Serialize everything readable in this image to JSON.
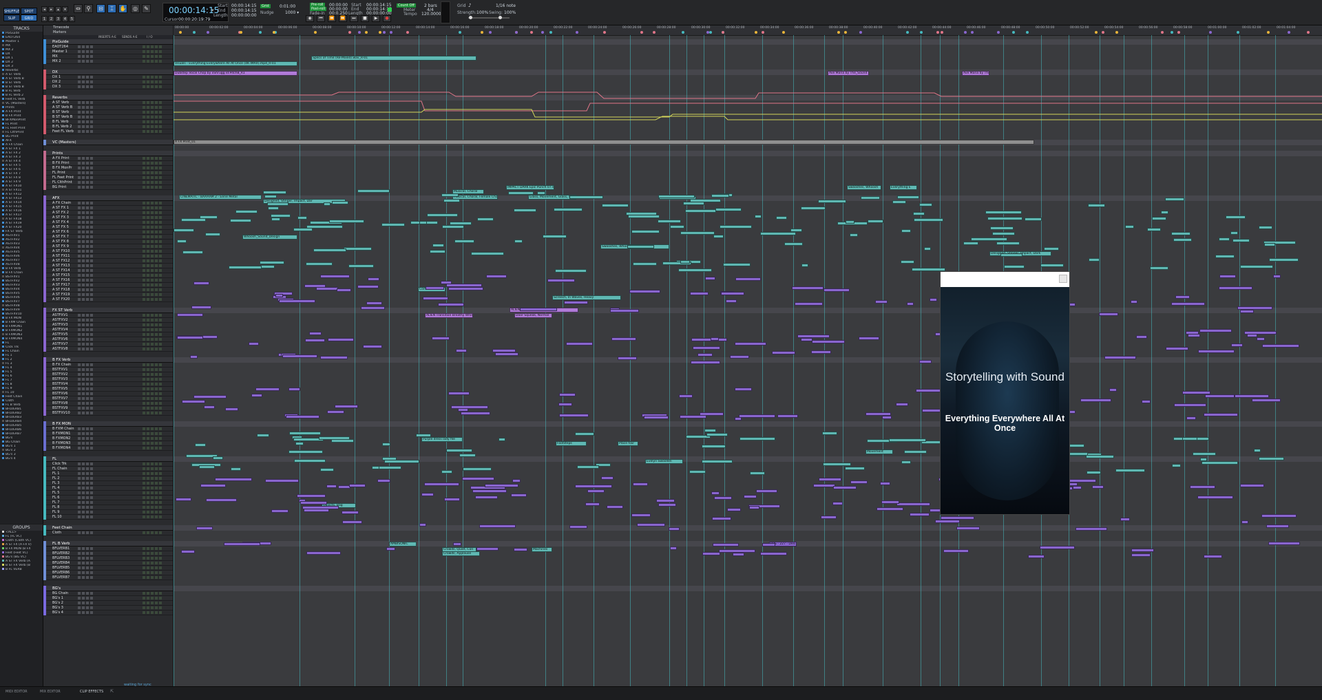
{
  "transport": {
    "mode_buttons": [
      "SHUFFLE",
      "SPOT",
      "SLIP",
      "GRID"
    ],
    "counter_main": "00:00:14:15",
    "counter_caret": "▾",
    "start_label": "Start",
    "start_value": "00:00:14:15",
    "end_label": "End",
    "end_value": "00:00:14:15",
    "length_label": "Length",
    "length_value": "00:00:00:00",
    "cursor_label": "Cursor",
    "cursor_value": "00:00:20:19:79",
    "grid_badge": "Grid",
    "grid_value": "0:01:00",
    "nudge_label": "Nudge",
    "nudge_value": "1000 ▾",
    "pre_label": "Pre-roll",
    "post_label": "Post-roll",
    "fadein_label": "Fade-in",
    "pre_value": "00:00:00",
    "post_value": "00:00:00",
    "fadein_value": "00:0.250",
    "start2_value": "00:00:14:15",
    "end2_value": "00:00:14:15",
    "length2_value": "00:00:00:00",
    "countoff_label": "Count Off",
    "countoff_value": "2 bars",
    "meter_label": "Meter",
    "meter_value": "4/4",
    "tempo_label": "Tempo",
    "tempo_value": "120.0000",
    "grid2_label": "Grid",
    "grid2_value": "1/16 note",
    "strength_label": "Strength:",
    "strength_value": "100%",
    "swing_label": "Swing:",
    "swing_value": "100%"
  },
  "tracks_panel": {
    "title": "TRACKS",
    "items": [
      "PixGuide",
      "EAOT264",
      "Master 1",
      "MX",
      "MX 2",
      "DX",
      "DX 1",
      "DX 2",
      "DX 3",
      "Reverbs",
      "A ST Verb",
      "A ST Verb B",
      "B ST Verb",
      "B ST Verb B",
      "B FL Verb",
      "B FL Verb 2",
      "Feet FL Verb",
      "VC (Masters)",
      "Prints",
      "A FX Print",
      "B FX Print",
      "BFXMonPrint",
      "FL Print",
      "FL Feet Print",
      "FL ClthPrint",
      "BG Print",
      "AFX",
      "A FX Chain",
      "A ST FX 1",
      "A ST FX 2",
      "A ST FX 3",
      "A ST FX 4",
      "A ST FX 5",
      "A ST FX 6",
      "A ST FX 7",
      "A ST FX 8",
      "A ST FX 9",
      "A ST FX10",
      "A ST FX11",
      "A ST FX12",
      "A ST FX13",
      "A ST FX14",
      "A ST FX15",
      "A ST FX16",
      "A ST FX17",
      "A ST FX18",
      "A ST FX19",
      "A ST FX20",
      "FX ST Verb",
      "ASTFXV1",
      "ASTFXV2",
      "ASTFXV3",
      "ASTFXV4",
      "ASTFXV5",
      "ASTFXV6",
      "ASTFXV7",
      "ASTFXV8",
      "B FX Verb",
      "B FX Chain",
      "BSTFXV1",
      "BSTFXV2",
      "BSTFXV3",
      "BSTFXV4",
      "BSTFXV5",
      "BSTFXV6",
      "BSTFXV7",
      "BSTFXV8",
      "BSTFXV9",
      "BSTFXV10",
      "B FX MON",
      "B FXM Chain",
      "B FXMON1",
      "B FXMON2",
      "B FXMON3",
      "B FXMON4",
      "FL",
      "Click Trk",
      "FL Chain",
      "FL 1",
      "FL 2",
      "FL 3",
      "FL 4",
      "FL 5",
      "FL 6",
      "FL 7",
      "FL 8",
      "FL 9",
      "FL 10",
      "Feet Chain",
      "Cloth",
      "FL B Verb",
      "BFLVERB1",
      "BFLVERB2",
      "BFLVERB3",
      "BFLVERB4",
      "BFLVERB5",
      "BFLVERB6",
      "BFLVERB7",
      "BG's",
      "BG Chain",
      "BG's 1",
      "BG's 2",
      "BG's 3",
      "BG's 4"
    ]
  },
  "groups_panel": {
    "title": "GROUPS",
    "items": [
      "<ALL>",
      "FL (FL VC)",
      "Cloth (Cloth VC)",
      "A ST FX (A FX V)",
      "B FX MON (B FX",
      "Feet (Feet VC)",
      "BG's (BG VC)",
      "A ST FX Verb (A",
      "B ST FX Verb (B",
      "B FL VERB"
    ]
  },
  "headers_top": {
    "timecode": "Timecode",
    "markers": "Markers",
    "inserts": "INSERTS A-E",
    "sends": "SENDS A-E",
    "io": "I / O"
  },
  "folders": [
    {
      "name": "PixGuide",
      "tracks": [
        "EAOT264",
        "Master 1",
        "MX",
        "MX 2"
      ]
    },
    {
      "name": "DX",
      "tracks": [
        "DX 1",
        "DX 2",
        "DX 3"
      ]
    },
    {
      "name": "Reverbs",
      "tracks": [
        "A ST Verb",
        "A ST Verb B",
        "B ST Verb",
        "B ST Verb B",
        "B FL Verb",
        "B FL Verb 2",
        "Feet FL Verb"
      ]
    },
    {
      "name": "VC (Masters)",
      "tracks": []
    },
    {
      "name": "Prints",
      "tracks": [
        "A FX Print",
        "B FX Print",
        "B FX MonPr",
        "FL Print",
        "FL Feet Print",
        "FL ClthPrint",
        "BG Print"
      ]
    },
    {
      "name": "AFX",
      "tracks": [
        "A FX Chain",
        "A ST FX 1",
        "A ST FX 2",
        "A ST FX 3",
        "A ST FX 4",
        "A ST FX 5",
        "A ST FX 6",
        "A ST FX 7",
        "A ST FX 8",
        "A ST FX 9",
        "A ST FX10",
        "A ST FX11",
        "A ST FX12",
        "A ST FX13",
        "A ST FX14",
        "A ST FX15",
        "A ST FX16",
        "A ST FX17",
        "A ST FX18",
        "A ST FX19",
        "A ST FX20"
      ]
    },
    {
      "name": "FX ST Verb",
      "tracks": [
        "ASTFXV1",
        "ASTFXV2",
        "ASTFXV3",
        "ASTFXV4",
        "ASTFXV5",
        "ASTFXV6",
        "ASTFXV7",
        "ASTFXV8"
      ]
    },
    {
      "name": "B FX Verb",
      "tracks": [
        "B FX Chain",
        "BSTFXV1",
        "BSTFXV2",
        "BSTFXV3",
        "BSTFXV4",
        "BSTFXV5",
        "BSTFXV6",
        "BSTFXV7",
        "BSTFXV8",
        "BSTFXV9",
        "BSTFXV10"
      ]
    },
    {
      "name": "B FX MON",
      "tracks": [
        "B FXM Chain",
        "B FXMON1",
        "B FXMON2",
        "B FXMON3",
        "B FXMON4"
      ]
    },
    {
      "name": "FL",
      "tracks": [
        "Click Trk",
        "FL Chain",
        "FL 1",
        "FL 2",
        "FL 3",
        "FL 4",
        "FL 5",
        "FL 6",
        "FL 7",
        "FL 8",
        "FL 9",
        "FL 10"
      ]
    },
    {
      "name": "Feet Chain",
      "tracks": [
        "Cloth"
      ]
    },
    {
      "name": "FL B Verb",
      "tracks": [
        "BFLVERB1",
        "BFLVERB2",
        "BFLVERB3",
        "BFLVERB4",
        "BFLVERB5",
        "BFLVERB6",
        "BFLVERB7"
      ]
    },
    {
      "name": "BG's",
      "tracks": [
        "BG Chain",
        "BG's 1",
        "BG's 2",
        "BG's 3",
        "BG's 4"
      ]
    }
  ],
  "ruler_labels": [
    "00:00:00",
    "00:00:02:00",
    "00:00:04:00",
    "00:00:06:00",
    "00:00:08:00",
    "00:00:10:00",
    "00:00:12:00",
    "00:00:14:00",
    "00:00:16:00",
    "00:00:18:00",
    "00:00:20:00",
    "00:00:22:00",
    "00:00:24:00",
    "00:00:26:00",
    "00:00:28:00",
    "00:00:30:00",
    "00:00:32:00",
    "00:00:34:00",
    "00:00:36:00",
    "00:00:38:00",
    "00:00:40:00",
    "00:00:42:00",
    "00:00:44:00",
    "00:00:46:00",
    "00:00:48:00",
    "00:00:50:00",
    "00:00:52:00",
    "00:00:54:00",
    "00:00:56:00",
    "00:00:58:00",
    "00:01:00:00",
    "00:01:02:00",
    "00:01:04:00"
  ],
  "clip_labels": [
    "Visuals - Everything Everywhere All At Once (4K IMAX).mp4_R-01",
    "Specs of Time (Re-Mixed).wav_R-01",
    "Dubstep Vocal Chop by xShrugg Id:Pitch8_R1",
    "Ave Maria by The_Sound",
    "Ave Maria by The",
    "A FX Print_01",
    "CINEMATIC - BAAAAM 2 - Eerie Metal",
    "Designed, Stinger, Impact, Dar",
    "Musical, Choral",
    "IMPACT DARK Epic Punch 07.wav",
    "Musical, Choral, Female Choir",
    "Glass, Movement, Glass, S",
    "Whoosh_Sound_Design",
    "Swooshes, Whoosh, Classic, Dark",
    "Designed, Stinger, Impact, Dark",
    "Swooshes, Whoosh",
    "Everything E",
    "Communicat",
    "Screech, In Waves, Heavy",
    "ALIEN Transition Breathy Whispe",
    "Door Squeak, Normal",
    "ALIEN FX Dementor",
    "Purple dress lady file",
    "Footsteps",
    "Place hair",
    "Evelyn Swoollen",
    "Movement",
    "Objects, Bag",
    "AMBISONIC",
    "Crowds, Quiet, Con",
    "Machines",
    "Crowds, Applause",
    "UPS - 227 - Desi"
  ],
  "video": {
    "tagline": "Storytelling with Sound",
    "title": "Everything Everywhere All At Once"
  },
  "bottom_tabs": [
    "MIDI EDITOR",
    "MIX EDITOR",
    "CLIP EFFECTS"
  ],
  "status": "waiting for sync",
  "colors": {
    "accent": "#2e6db4",
    "grid_line": "#46b9be",
    "clip_teal": "#5fb8b3",
    "clip_purple": "#8a66cf",
    "automation_red": "#e07588",
    "automation_yellow": "#d4d65a"
  }
}
